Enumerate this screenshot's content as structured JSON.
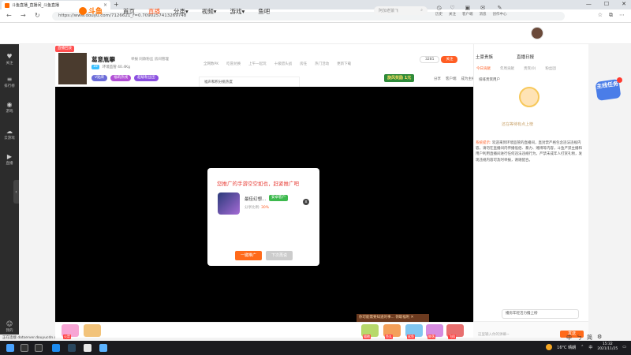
{
  "browser": {
    "tab_title": "斗鱼直播_直播间_斗鱼直播",
    "url": "https://www.douyu.com/7126621_r=0.7090257413269748",
    "new_tab_icon": "plus-icon"
  },
  "site": {
    "logo_text": "斗鱼",
    "nav": [
      "首页",
      "直播",
      "分类▾",
      "视频▾",
      "游戏▾",
      "鱼吧"
    ],
    "search_placeholder": "阿加老猿飞",
    "header_icons": [
      "历史",
      "关注",
      "客户端",
      "消息",
      "创作中心"
    ]
  },
  "sidebar": {
    "items": [
      "关注",
      "排行榜",
      "游戏",
      "云游戏",
      "直播"
    ],
    "bottom": "我的"
  },
  "room": {
    "live_badge": "直播回放",
    "host_name": "葛意胤攀",
    "meta": "举报  同款粉丝  房间管理",
    "sub_level": "18",
    "sub_text": "环境监管  40.4Kg",
    "tags": [
      "V贴荣",
      "福莉热线",
      "超级粉丝团"
    ],
    "rank_strip": [
      "全网数PK",
      "吃冒兑换",
      "上午一起玩",
      "十级猎头战",
      "房任",
      "热门活动",
      "更新下载"
    ],
    "rank_popup": "福声和积分挑热度",
    "follow_count": "3281",
    "follow_label": "关注",
    "rank_badge": "旋风奖励 1元",
    "share": [
      "分享",
      "客户端",
      "成为主播"
    ]
  },
  "modal": {
    "title": "您推广的手游空空如也，赶紧推广吧",
    "game_name": "最佳幻想...",
    "game_tag": "安卓客户",
    "share_label": "分享比例:",
    "share_pct": "30%",
    "close_icon": "x",
    "btn_promote": "一键推广",
    "btn_skip": "下次再说"
  },
  "promo": {
    "text": "你可能需要知道的事... 领取福利 ✕"
  },
  "gifts": [
    "猫粮",
    "鱼丸",
    "鲨鱼",
    "鲸落",
    "飞机",
    "火箭"
  ],
  "right_panel": {
    "headers": [
      "土豪贵族",
      "直播日报"
    ],
    "tabs": [
      "今日贡献",
      "年周贡献",
      "贵宾(0)",
      "粉丝团"
    ],
    "list_title": "排排贵宾用户",
    "illus_caption": "还在等待有点上榜",
    "notice_label": "系统提示:",
    "notice_text": "欢迎来到环境监管的直播间，直封禁严格包含违法违规内容，请勿在直播间内传播低俗、暴力、赌博等内容，斗鱼严禁主播和用户利用直播间进行任何违法违规行为，严禁未成年人打赏礼物，发现违规内容可及时举报，谢谢配合。",
    "chat_popup": "播房年轻活力撸上榜",
    "chat_placeholder": "这里输入你的弹幕~",
    "send_label": "发送"
  },
  "task": {
    "label": "主线任务"
  },
  "ime": [
    "中",
    "ㄅ",
    "简",
    "⚙"
  ],
  "status": {
    "text": "正在连接 dotserver.douyucdn.cn..."
  },
  "taskbar": {
    "weather": "16°C 晴朗",
    "time": "15:32",
    "date": "2021/11/25",
    "lang": "中"
  },
  "colors": {
    "accent": "#ff5d23",
    "player_bg": "#000000",
    "sidebar_bg": "#2c2c2c"
  }
}
